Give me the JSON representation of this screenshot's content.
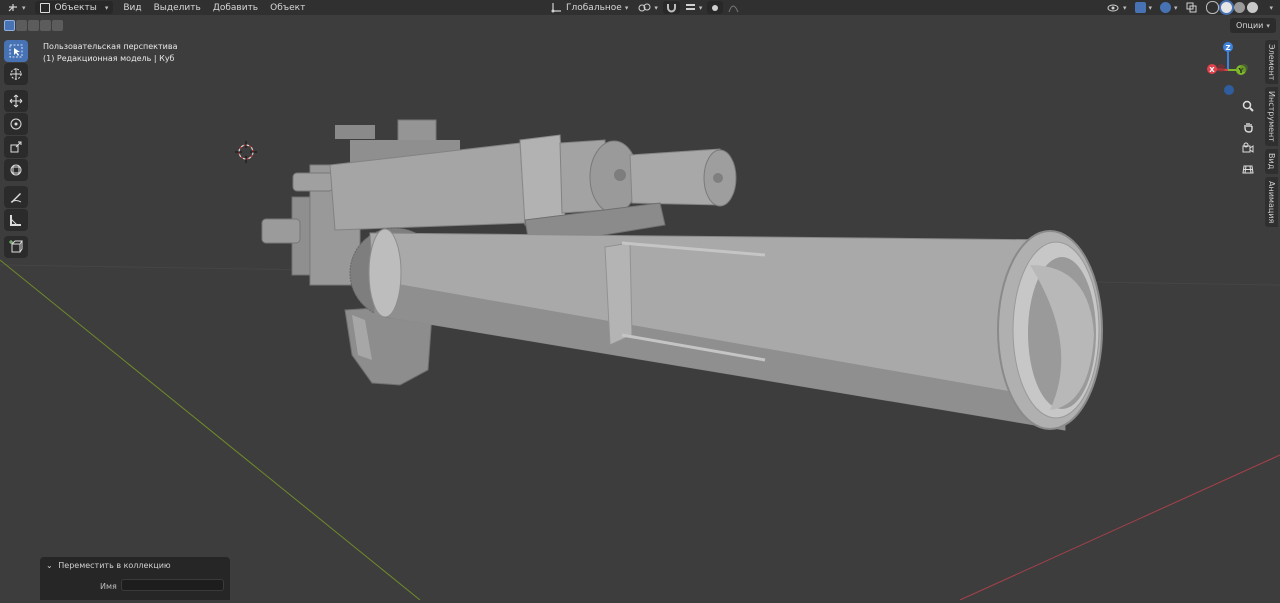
{
  "header": {
    "mode_label": "Объекты",
    "menu": [
      "Вид",
      "Выделить",
      "Добавить",
      "Объект"
    ],
    "orientation_label": "Глобальное"
  },
  "options_label": "Опции",
  "viewport": {
    "view_name": "Пользовательская перспектива",
    "object_info": "(1) Редакционная модель | Куб"
  },
  "gizmo": {
    "x_label": "X",
    "y_label": "Y",
    "z_label": "Z"
  },
  "sidebar_tabs": [
    "Элемент",
    "Инструмент",
    "Вид",
    "Анимация"
  ],
  "redo_panel": {
    "title": "Переместить в коллекцию",
    "name_label": "Имя",
    "name_value": ""
  },
  "colors": {
    "background": "#3d3d3d",
    "header": "#303030",
    "accent": "#4772b3",
    "axis_x": "#e0424c",
    "axis_y": "#7fb92a",
    "axis_z": "#3f82de"
  }
}
